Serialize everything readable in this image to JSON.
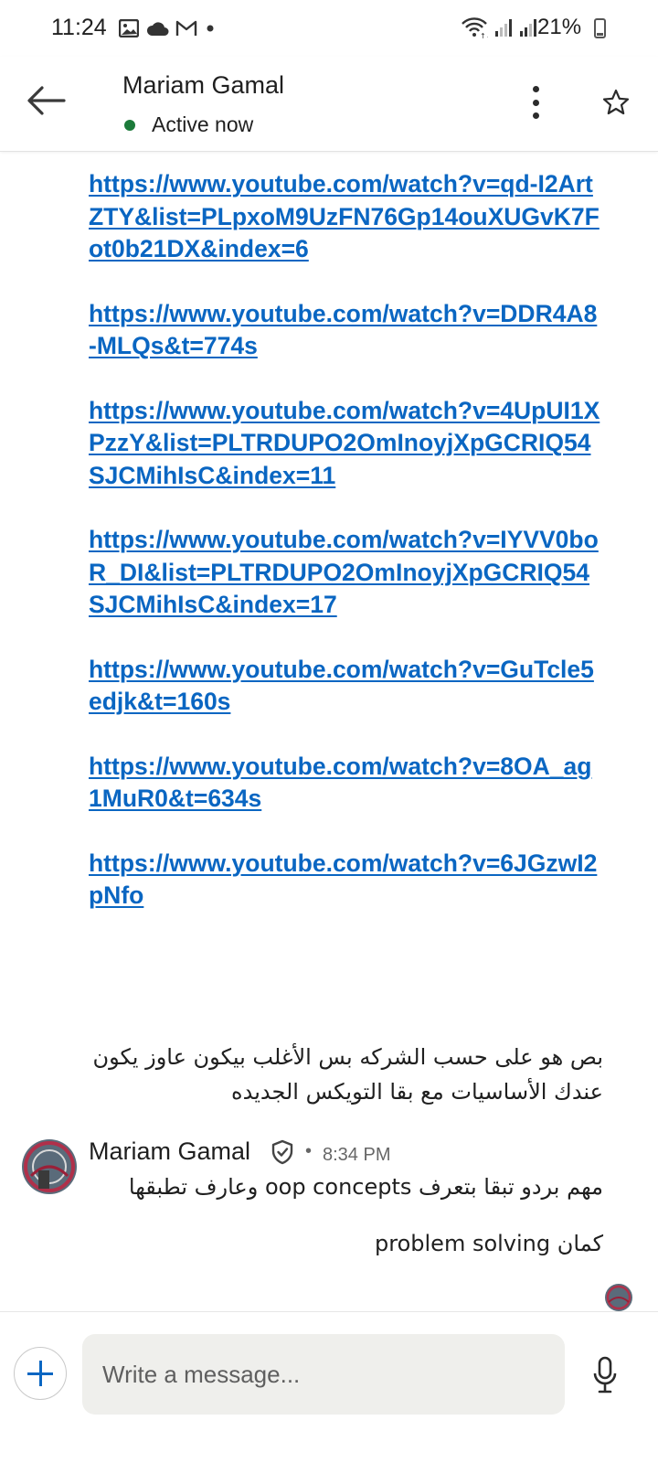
{
  "status_bar": {
    "time": "11:24",
    "left_icons": [
      "gallery-icon",
      "cloud-icon",
      "gmail-icon",
      "dot-icon"
    ],
    "right_icons": [
      "wifi-icon",
      "signal-icon",
      "signal-icon"
    ],
    "battery": "21%"
  },
  "header": {
    "name": "Mariam Gamal",
    "status": "Active now",
    "status_color": "#1c7a3a"
  },
  "messages": {
    "links": [
      "https://www.youtube.com/watch?v=qd-I2ArtZTY&list=PLpxoM9UzFN76Gp14ouXUGvK7Fot0b21DX&index=6",
      "https://www.youtube.com/watch?v=DDR4A8-MLQs&t=774s",
      "https://www.youtube.com/watch?v=4UpUI1XPzzY&list=PLTRDUPO2OmInoyjXpGCRIQ54SJCMihIsC&index=11",
      "https://www.youtube.com/watch?v=IYVV0boR_DI&list=PLTRDUPO2OmInoyjXpGCRIQ54SJCMihIsC&index=17",
      "https://www.youtube.com/watch?v=GuTcle5edjk&t=160s",
      "https://www.youtube.com/watch?v=8OA_ag1MuR0&t=634s",
      "https://www.youtube.com/watch?v=6JGzwI2pNfo"
    ],
    "arabic_1": "بص هو على حسب الشركه بس الأغلب بيكون عاوز يكون عندك الأساسيات مع بقا التويكس الجديده",
    "sender": {
      "name": "Mariam Gamal",
      "separator": "•",
      "time": "8:34 PM"
    },
    "arabic_2": "مهم بردو تبقا بتعرف oop concepts وعارف تطبقها",
    "arabic_3": "كمان problem solving"
  },
  "composer": {
    "placeholder": "Write a message..."
  },
  "colors": {
    "link": "#0a66c2",
    "accent": "#0a66c2"
  }
}
